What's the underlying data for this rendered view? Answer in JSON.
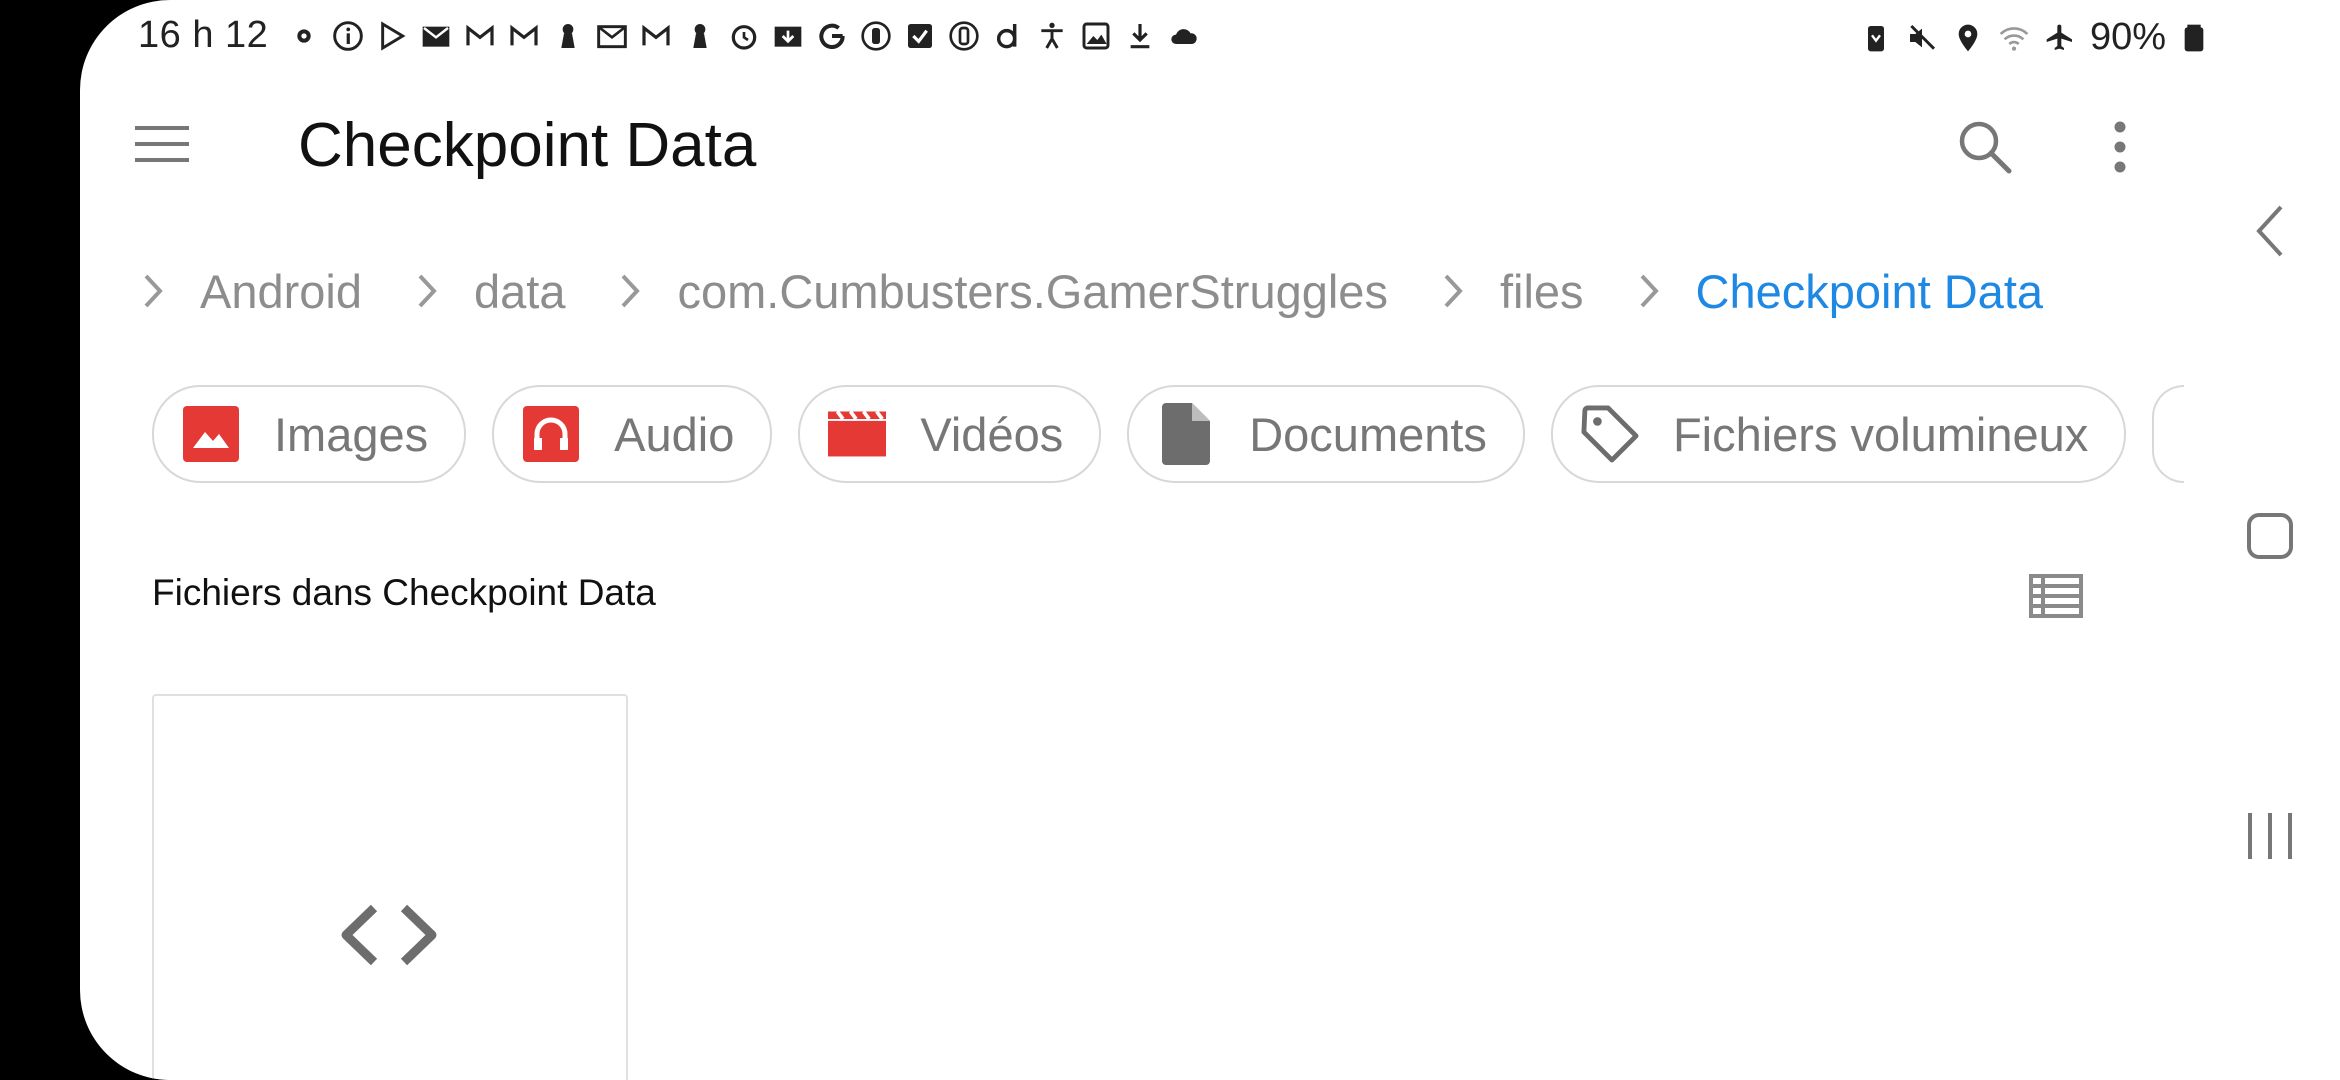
{
  "status_bar": {
    "time": "16 h 12",
    "battery": "90%",
    "left_icons": [
      "settings-icon",
      "info-icon",
      "play-store-icon",
      "email-icon",
      "gmail-icon",
      "gmail-icon",
      "keyhole-icon",
      "email-icon",
      "gmail-icon",
      "keyhole-icon",
      "alarm-icon",
      "download-box-icon",
      "google-icon",
      "circle-icon",
      "checkbox-icon",
      "circle-icon",
      "d-icon",
      "accessibility-icon",
      "image-icon",
      "download-icon",
      "cloud-icon"
    ],
    "right_icons": [
      "battery-saver-icon",
      "mute-icon",
      "location-icon",
      "wifi-icon",
      "airplane-icon"
    ]
  },
  "toolbar": {
    "title": "Checkpoint Data",
    "menu_icon": "hamburger-icon",
    "search_icon": "search-icon",
    "more_icon": "more-vert-icon"
  },
  "breadcrumb": {
    "items": [
      "Android",
      "data",
      "com.Cumbusters.GamerStruggles",
      "files",
      "Checkpoint Data"
    ]
  },
  "chips": [
    {
      "label": "Images",
      "icon": "image-icon",
      "color": "#e53935"
    },
    {
      "label": "Audio",
      "icon": "headphones-icon",
      "color": "#e53935"
    },
    {
      "label": "Vidéos",
      "icon": "video-clapper-icon",
      "color": "#e53935"
    },
    {
      "label": "Documents",
      "icon": "document-icon",
      "color": "#6d6d6d"
    },
    {
      "label": "Fichiers volumineux",
      "icon": "tag-icon",
      "color": "#6d6d6d"
    }
  ],
  "section": {
    "title": "Fichiers dans Checkpoint Data",
    "view_icon": "list-view-icon"
  },
  "files": [
    {
      "icon": "code-icon"
    }
  ],
  "colors": {
    "accent": "#1e88e5",
    "chip_red": "#e53935",
    "muted_text": "#8d8d8d"
  }
}
